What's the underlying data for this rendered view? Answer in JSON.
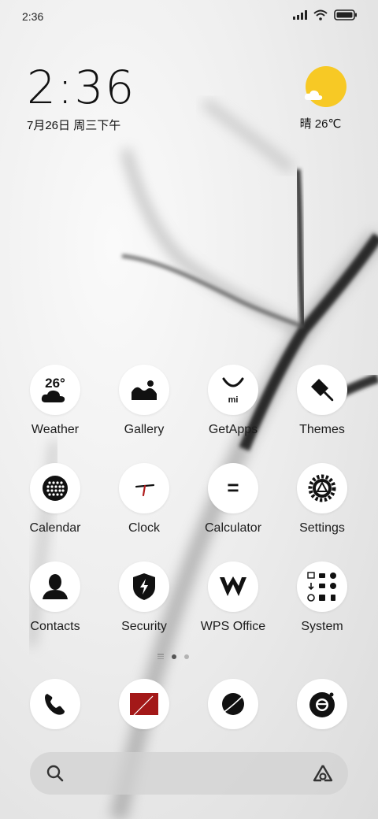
{
  "status_bar": {
    "time": "2:36"
  },
  "clock_widget": {
    "time": "2:36",
    "date": "7月26日 周三下午"
  },
  "weather_widget": {
    "condition_temp": "晴 26℃",
    "sun_color": "#f7c925"
  },
  "apps": {
    "weather": {
      "label": "Weather",
      "badge": "26°"
    },
    "gallery": {
      "label": "Gallery"
    },
    "getapps": {
      "label": "GetApps",
      "badge": "mi"
    },
    "themes": {
      "label": "Themes"
    },
    "calendar": {
      "label": "Calendar"
    },
    "clock": {
      "label": "Clock"
    },
    "calculator": {
      "label": "Calculator",
      "badge": "="
    },
    "settings": {
      "label": "Settings"
    },
    "contacts": {
      "label": "Contacts"
    },
    "security": {
      "label": "Security"
    },
    "wps": {
      "label": "WPS Office"
    },
    "system": {
      "label": "System"
    }
  },
  "dock": {
    "phone": "phone-icon",
    "messages": "messages-icon",
    "browser": "browser-icon",
    "camera": "camera-icon"
  },
  "search": {
    "icon": "search-icon",
    "assistant": "assistant-icon"
  },
  "colors": {
    "accent_red": "#a31818",
    "sun": "#f7c925"
  }
}
